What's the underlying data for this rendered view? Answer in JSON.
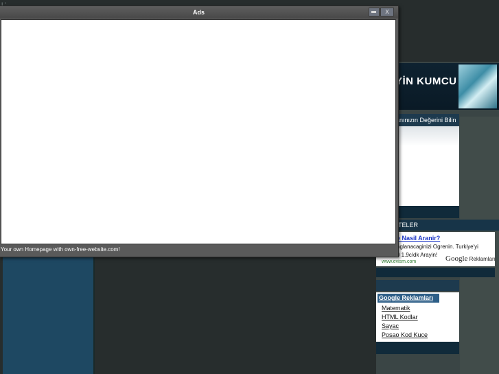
{
  "page": {
    "top_text": "L' ... ..."
  },
  "header": {
    "title": "YİN KUMCU",
    "subtitle": "anınızın Değerini Bilin"
  },
  "section": {
    "title": "TELER"
  },
  "ad": {
    "link": "e Nasil Aranir?",
    "line1": "aglanacaginizi Ogrenin. Turkiye'yi",
    "line2": "0 1.9c/dk Arayin!",
    "url": "www.evism.com",
    "google_brand": "Google",
    "google_suffix": "Reklamları"
  },
  "google_box": {
    "header": "Google Reklamları",
    "links": [
      "Matematik",
      "HTML Kodlar",
      "Sayac",
      "Posao Kod Kuce"
    ]
  },
  "window": {
    "title": "Ads",
    "status": "Your own Homepage with own-free-website.com!",
    "close_label": "X"
  }
}
